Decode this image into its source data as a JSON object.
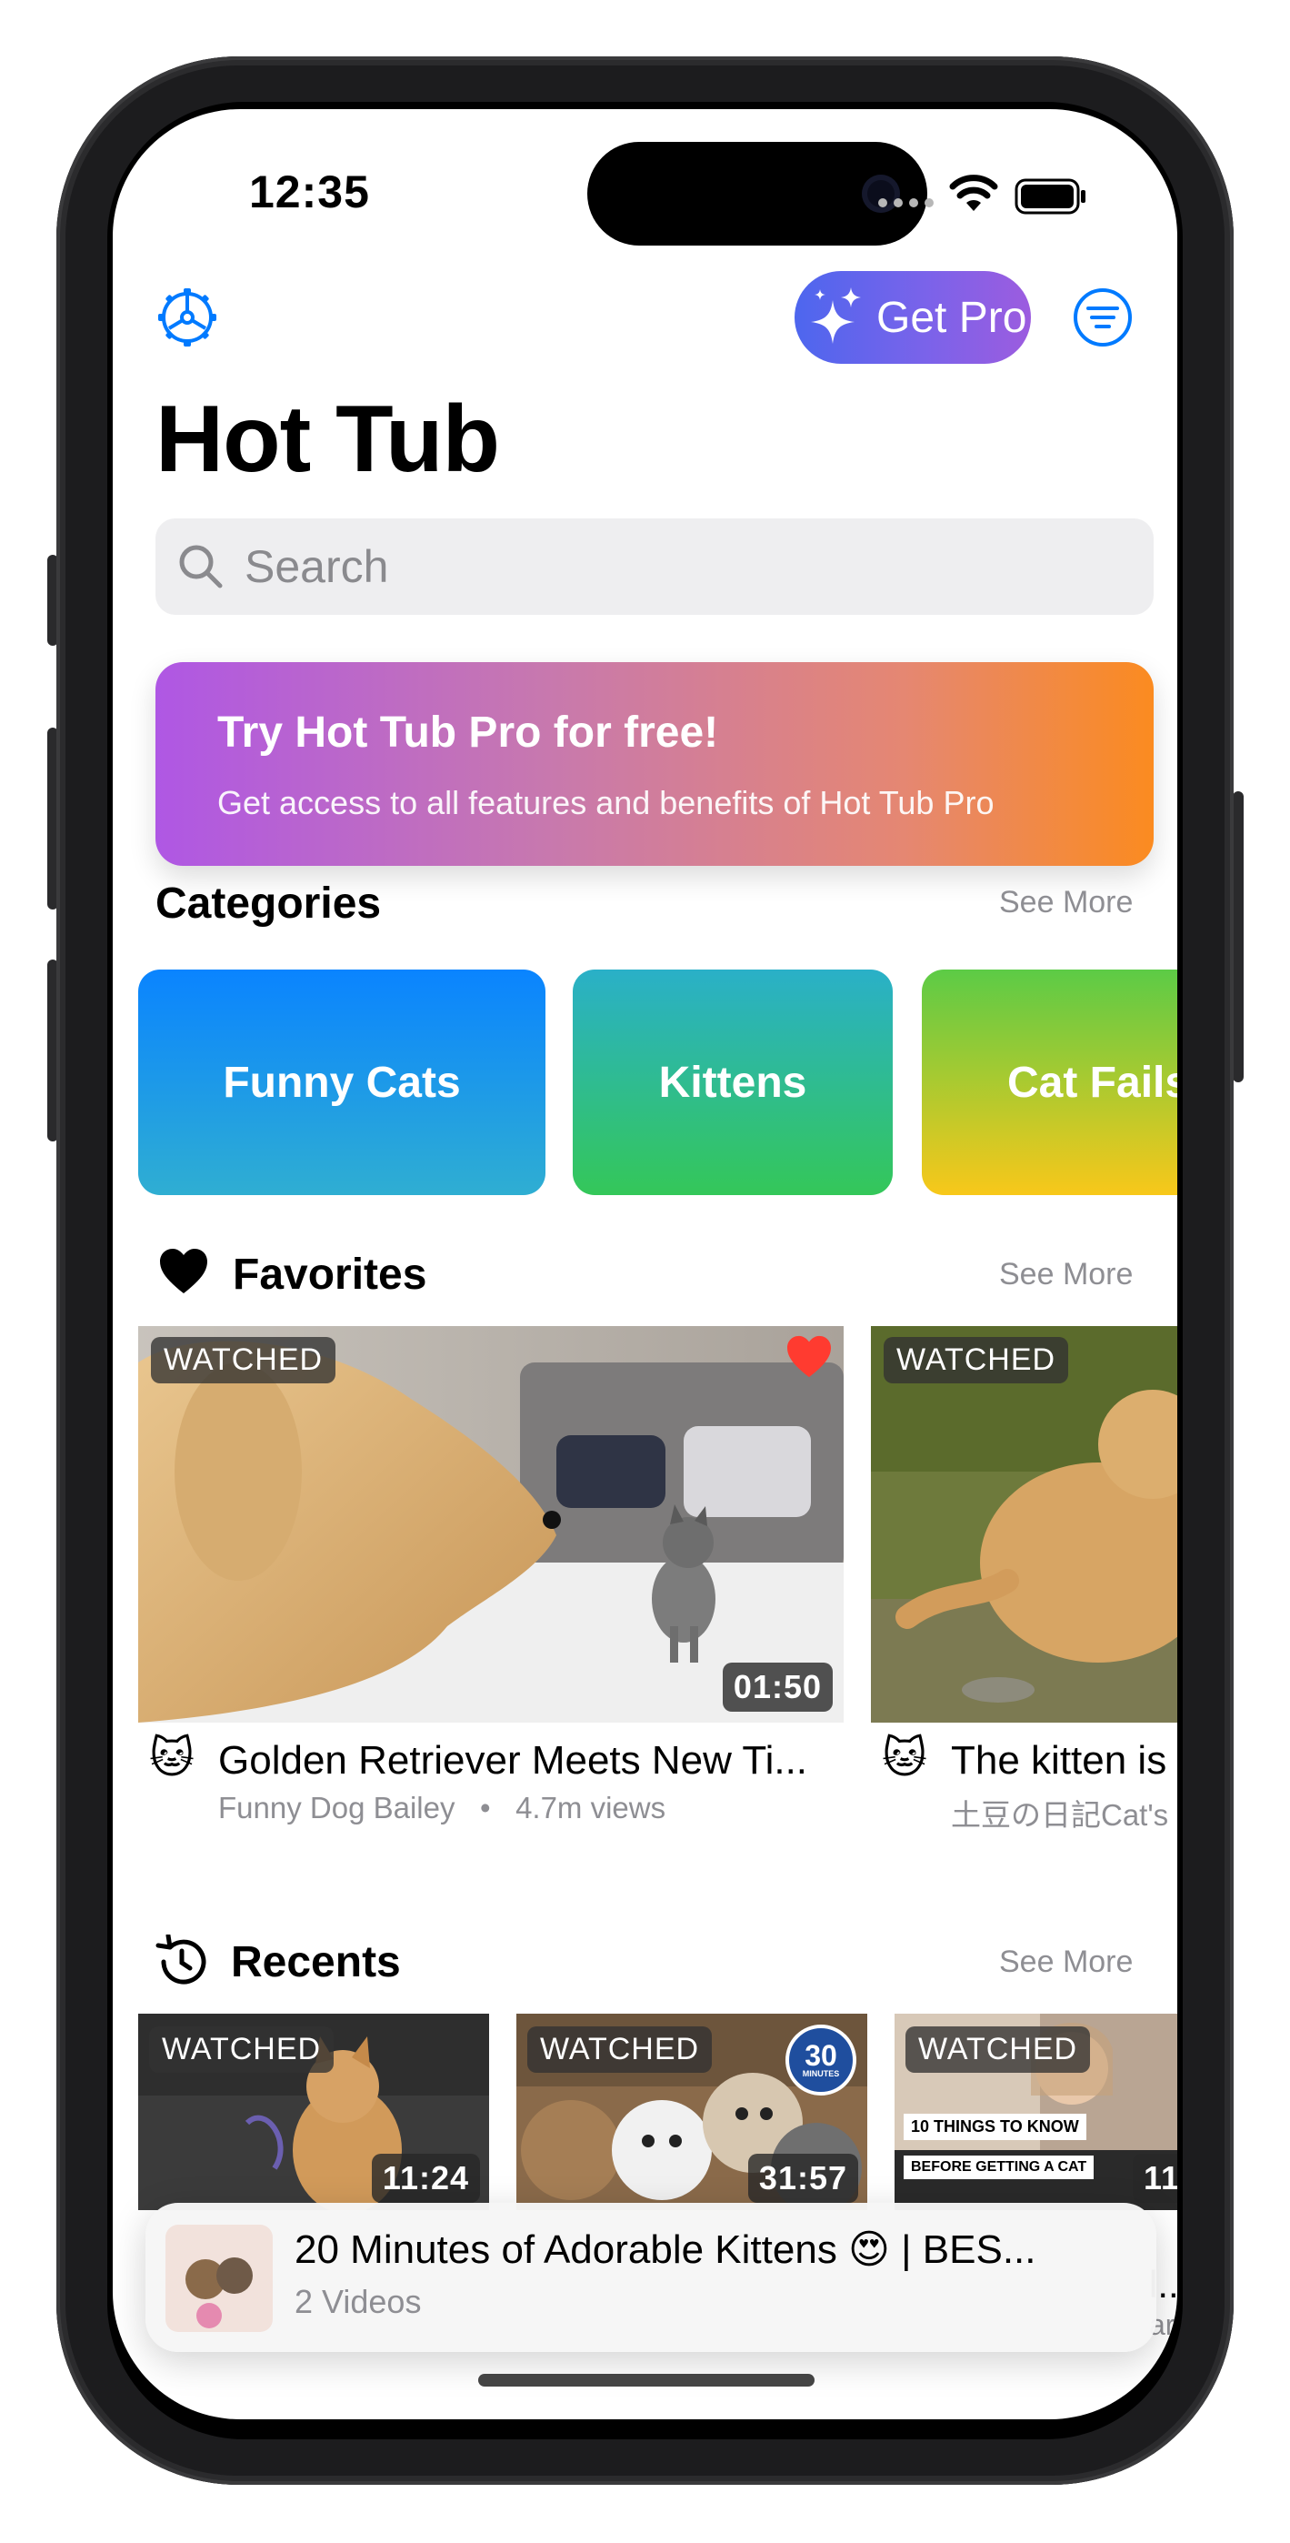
{
  "status_bar": {
    "time": "12:35"
  },
  "header": {
    "get_pro_label": "Get Pro",
    "title": "Hot Tub"
  },
  "search": {
    "placeholder": "Search"
  },
  "promo": {
    "title": "Try Hot Tub Pro for free!",
    "subtitle": "Get access to all features and benefits of Hot Tub Pro"
  },
  "categories": {
    "title": "Categories",
    "see_more": "See More",
    "items": [
      {
        "label": "Funny Cats"
      },
      {
        "label": "Kittens"
      },
      {
        "label": "Cat Fails"
      }
    ]
  },
  "favorites": {
    "title": "Favorites",
    "see_more": "See More",
    "items": [
      {
        "badge": "WATCHED",
        "duration": "01:50",
        "emoji": "🐱",
        "title": "Golden Retriever Meets New Ti...",
        "channel": "Funny Dog Bailey",
        "views": "4.7m views"
      },
      {
        "badge": "WATCHED",
        "emoji": "🐱",
        "title": "The kitten is",
        "channel": "土豆の日記Cat's"
      }
    ]
  },
  "recents": {
    "title": "Recents",
    "see_more": "See More",
    "items": [
      {
        "badge": "WATCHED",
        "duration": "11:24"
      },
      {
        "badge": "WATCHED",
        "duration": "31:57",
        "circle_top": "30",
        "circle_bottom": "MINUTES"
      },
      {
        "badge": "WATCHED",
        "duration": "11:",
        "overlay_line1": "10 THINGS TO KNOW",
        "overlay_line2": "BEFORE GETTING A CAT"
      }
    ]
  },
  "mini_player": {
    "title": "20 Minutes of Adorable Kittens 😍 | BES...",
    "subtitle": "2 Videos",
    "behind_fragment": "l..",
    "behind_fragment2": "art"
  },
  "colors": {
    "accent": "#007AFF",
    "promo_gradient": [
      "#AF57E4",
      "#FB8B20"
    ],
    "get_pro_gradient": [
      "#4D66EE",
      "#9C5CDF"
    ],
    "funny_cats_gradient": [
      "#0A84FF",
      "#2FAFD0"
    ],
    "kittens_gradient": [
      "#2AB0C8",
      "#34C759"
    ],
    "cat_fails_gradient": [
      "#5CCB46",
      "#F8C81A"
    ],
    "favorite_heart": "#FF3B30"
  }
}
